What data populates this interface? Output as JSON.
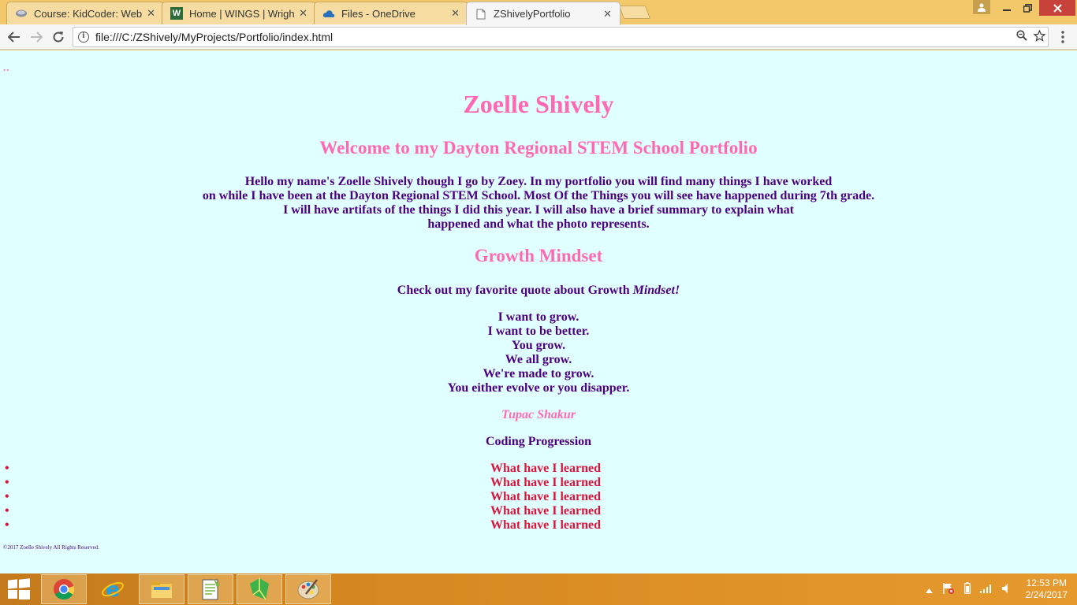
{
  "browser": {
    "tabs": [
      {
        "title": "Course: KidCoder: Web D",
        "icon": "moodle-icon",
        "active": false
      },
      {
        "title": "Home | WINGS | Wright S",
        "icon": "wings-icon",
        "active": false
      },
      {
        "title": "Files - OneDrive",
        "icon": "onedrive-icon",
        "active": false
      },
      {
        "title": "ZShivelyPortfolio",
        "icon": "page-icon",
        "active": true
      }
    ],
    "close_glyph": "✕",
    "url": "file:///C:/ZShively/MyProjects/Portfolio/index.html"
  },
  "page": {
    "dots": "..",
    "name": "Zoelle Shively",
    "welcome": "Welcome to my Dayton Regional STEM School Portfolio",
    "intro_lines": [
      "Hello my name's Zoelle Shively though I go by Zoey. In my portfolio you will find many things I have worked",
      "on while I have been at the Dayton Regional STEM School. Most Of the Things you will see have happened during 7th grade.",
      "I will have artifats of the things I did this year. I will also have a brief summary to explain what",
      "happened and what the photo represents."
    ],
    "growth_heading": "Growth Mindset",
    "quote_intro_prefix": "Check out my favorite quote about Growth ",
    "quote_intro_emph": "Mindset!",
    "quote_lines": [
      "I want to grow.",
      "I want to be better.",
      "You grow.",
      "We all grow.",
      "We're made to grow.",
      "You either evolve or you disapper."
    ],
    "author": "Tupac Shakur",
    "coding_heading": "Coding Progression",
    "learned_items": [
      "What have I learned",
      "What have I learned",
      "What have I learned",
      "What have I learned",
      "What have I learned"
    ],
    "copyright": "©2017 Zoelle Shively All Rights Reserved."
  },
  "taskbar": {
    "apps": [
      "chrome-icon",
      "internet-explorer-icon",
      "file-explorer-icon",
      "notepad-plus-plus-icon",
      "sketchup-icon",
      "paint-icon"
    ],
    "time": "12:53 PM",
    "date": "2/24/2017"
  },
  "colors": {
    "page_bg": "#e0ffff",
    "heading_pink": "#ff69b4",
    "body_indigo": "#4b0082",
    "link_crimson": "#dc143c",
    "tabstrip": "#f2c86a"
  }
}
